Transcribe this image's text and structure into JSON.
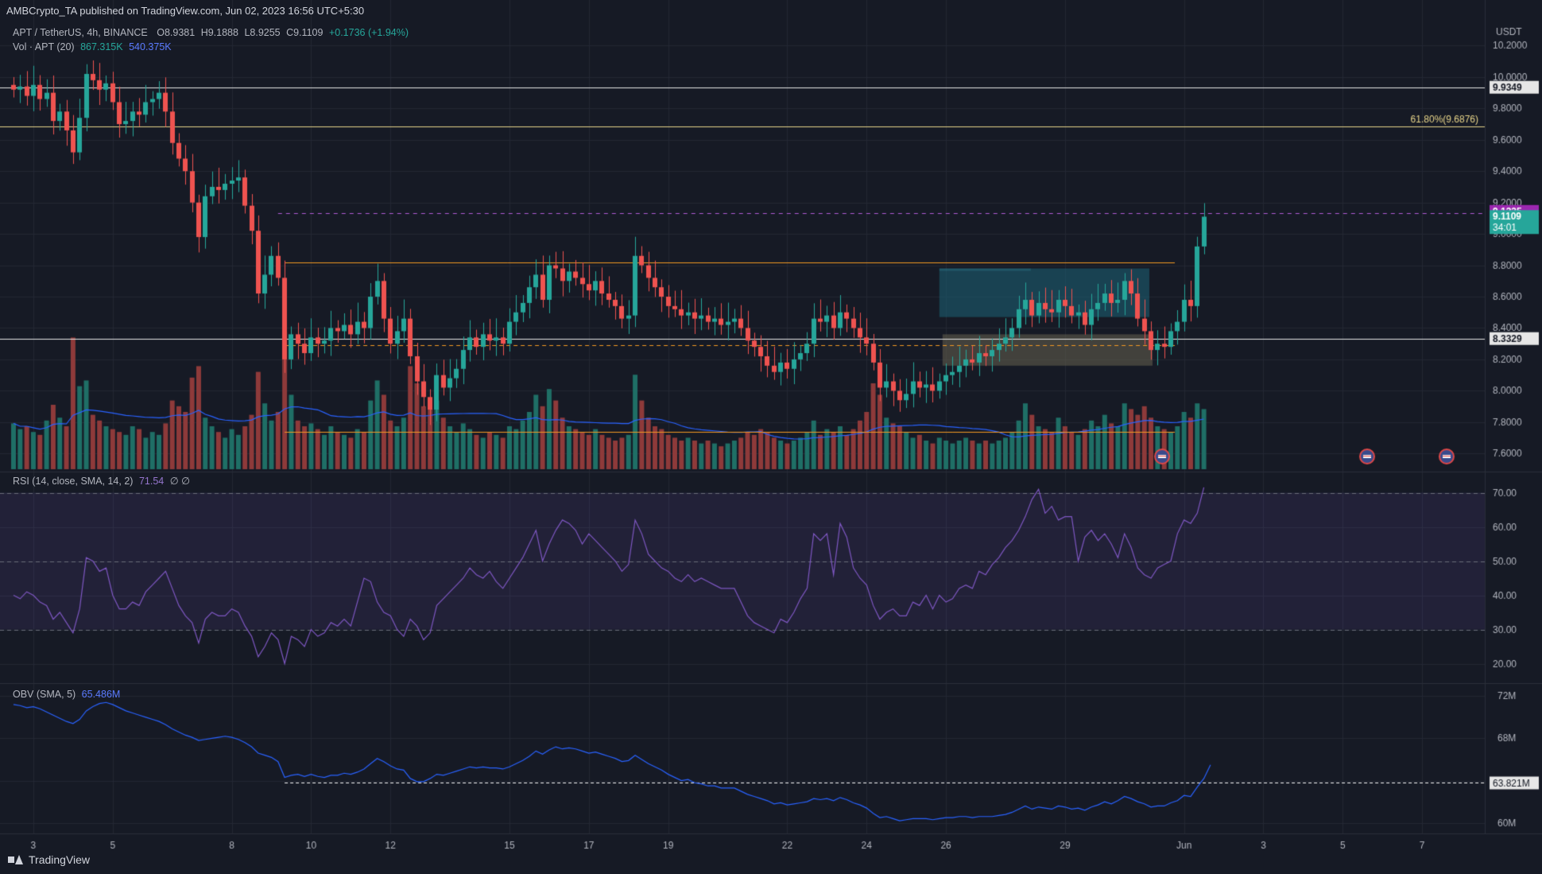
{
  "header": {
    "publisher": "AMBCrypto_TA published on TradingView.com, Jun 02, 2023 16:56 UTC+5:30"
  },
  "legend": {
    "symbol": "APT / TetherUS, 4h, BINANCE",
    "open": "O8.9381",
    "high": "H9.1888",
    "low": "L8.9255",
    "close": "C9.1109",
    "change": "+0.1736 (+1.94%)",
    "vol_label": "Vol · APT (20)",
    "vol_value": "867.315K",
    "vol_ma": "540.375K",
    "rsi_label": "RSI (14, close, SMA, 14, 2)",
    "rsi_value": "71.54",
    "rsi_extra": "∅ ∅",
    "obv_label": "OBV (SMA, 5)",
    "obv_value": "65.486M"
  },
  "brand": "TradingView",
  "colors": {
    "background": "#161a25",
    "up": "#26a69a",
    "down": "#ef5350",
    "vol_up": "#1f6f66",
    "vol_down": "#8e3a3a",
    "vol_ma": "#2962ff",
    "rsi": "#7e57c2",
    "obv": "#2962ff",
    "fib": "#e8d58a",
    "orange": "#f59a23",
    "pink_dash": "#b15bd6",
    "cyan_zone": "#1e5a6e",
    "gray_zone": "#5c5746",
    "price_tag": "#26a69a",
    "last_high_tag": "#9c27b0"
  },
  "chart_data": [
    {
      "type": "candlestick",
      "title": "APT / TetherUS, 4h, BINANCE",
      "y_unit": "USDT",
      "ylim": [
        7.5,
        10.4
      ],
      "price_ticks": [
        "10.2000",
        "10.0000",
        "9.8000",
        "9.6000",
        "9.4000",
        "9.2000",
        "9.0000",
        "8.8000",
        "8.6000",
        "8.4000",
        "8.2000",
        "8.0000",
        "7.8000",
        "7.6000"
      ],
      "x_ticks": [
        "3",
        "5",
        "8",
        "10",
        "12",
        "15",
        "17",
        "19",
        "22",
        "24",
        "26",
        "29",
        "Jun",
        "3",
        "5",
        "7"
      ],
      "x_tick_dates": [
        "2023-05-03",
        "2023-05-05",
        "2023-05-08",
        "2023-05-10",
        "2023-05-12",
        "2023-05-15",
        "2023-05-17",
        "2023-05-19",
        "2023-05-22",
        "2023-05-24",
        "2023-05-26",
        "2023-05-29",
        "2023-06-01",
        "2023-06-03",
        "2023-06-05",
        "2023-06-07"
      ],
      "bars_per_day": 6,
      "first_bar": "2023-05-02 12:00",
      "closes": [
        9.92,
        9.94,
        9.88,
        9.95,
        9.86,
        9.9,
        9.72,
        9.78,
        9.66,
        9.52,
        9.74,
        10.02,
        9.98,
        9.92,
        9.96,
        9.84,
        9.7,
        9.72,
        9.78,
        9.76,
        9.84,
        9.86,
        9.9,
        9.78,
        9.58,
        9.48,
        9.4,
        9.2,
        8.98,
        9.24,
        9.3,
        9.28,
        9.32,
        9.34,
        9.36,
        9.18,
        9.02,
        8.62,
        8.74,
        8.86,
        8.72,
        8.2,
        8.36,
        8.3,
        8.24,
        8.34,
        8.3,
        8.32,
        8.4,
        8.38,
        8.42,
        8.36,
        8.44,
        8.4,
        8.6,
        8.7,
        8.46,
        8.3,
        8.38,
        8.46,
        8.22,
        8.06,
        7.96,
        7.88,
        8.1,
        8.02,
        8.08,
        8.14,
        8.26,
        8.34,
        8.28,
        8.36,
        8.32,
        8.34,
        8.3,
        8.44,
        8.5,
        8.56,
        8.66,
        8.74,
        8.58,
        8.8,
        8.78,
        8.7,
        8.76,
        8.72,
        8.68,
        8.64,
        8.7,
        8.62,
        8.58,
        8.54,
        8.46,
        8.48,
        8.86,
        8.8,
        8.72,
        8.66,
        8.6,
        8.54,
        8.52,
        8.48,
        8.5,
        8.46,
        8.48,
        8.44,
        8.46,
        8.42,
        8.44,
        8.46,
        8.4,
        8.32,
        8.28,
        8.22,
        8.16,
        8.12,
        8.18,
        8.14,
        8.2,
        8.24,
        8.3,
        8.46,
        8.44,
        8.48,
        8.4,
        8.5,
        8.46,
        8.4,
        8.34,
        8.3,
        8.18,
        8.02,
        8.06,
        8.0,
        7.94,
        7.98,
        8.06,
        8.02,
        8.04,
        8.0,
        8.06,
        8.1,
        8.12,
        8.16,
        8.2,
        8.18,
        8.24,
        8.22,
        8.26,
        8.3,
        8.34,
        8.4,
        8.52,
        8.58,
        8.48,
        8.56,
        8.52,
        8.5,
        8.58,
        8.54,
        8.48,
        8.5,
        8.42,
        8.52,
        8.56,
        8.62,
        8.56,
        8.58,
        8.7,
        8.62,
        8.46,
        8.38,
        8.26,
        8.3,
        8.28,
        8.38,
        8.44,
        8.58,
        8.54,
        8.92,
        9.11
      ],
      "volume": [
        0.32,
        0.28,
        0.3,
        0.26,
        0.24,
        0.34,
        0.45,
        0.36,
        0.3,
        0.92,
        0.58,
        0.62,
        0.38,
        0.34,
        0.3,
        0.28,
        0.26,
        0.24,
        0.3,
        0.28,
        0.22,
        0.26,
        0.24,
        0.32,
        0.48,
        0.44,
        0.4,
        0.64,
        0.72,
        0.36,
        0.3,
        0.26,
        0.22,
        0.28,
        0.24,
        0.3,
        0.38,
        0.68,
        0.46,
        0.34,
        0.4,
        0.96,
        0.52,
        0.34,
        0.3,
        0.32,
        0.28,
        0.24,
        0.3,
        0.26,
        0.24,
        0.22,
        0.28,
        0.26,
        0.48,
        0.62,
        0.52,
        0.34,
        0.3,
        0.36,
        0.72,
        0.6,
        0.44,
        0.42,
        0.48,
        0.36,
        0.3,
        0.26,
        0.32,
        0.28,
        0.24,
        0.22,
        0.26,
        0.24,
        0.22,
        0.3,
        0.28,
        0.34,
        0.4,
        0.52,
        0.44,
        0.56,
        0.48,
        0.36,
        0.3,
        0.28,
        0.26,
        0.24,
        0.28,
        0.24,
        0.22,
        0.2,
        0.22,
        0.24,
        0.66,
        0.48,
        0.36,
        0.3,
        0.28,
        0.24,
        0.22,
        0.2,
        0.22,
        0.2,
        0.18,
        0.2,
        0.18,
        0.16,
        0.18,
        0.2,
        0.22,
        0.26,
        0.24,
        0.28,
        0.26,
        0.22,
        0.2,
        0.18,
        0.2,
        0.22,
        0.26,
        0.34,
        0.24,
        0.28,
        0.26,
        0.3,
        0.24,
        0.28,
        0.34,
        0.4,
        0.6,
        0.52,
        0.36,
        0.32,
        0.3,
        0.26,
        0.22,
        0.24,
        0.2,
        0.18,
        0.22,
        0.2,
        0.18,
        0.2,
        0.22,
        0.2,
        0.18,
        0.2,
        0.18,
        0.2,
        0.22,
        0.26,
        0.34,
        0.46,
        0.38,
        0.3,
        0.28,
        0.26,
        0.36,
        0.3,
        0.26,
        0.24,
        0.28,
        0.34,
        0.3,
        0.38,
        0.32,
        0.3,
        0.46,
        0.42,
        0.38,
        0.44,
        0.36,
        0.3,
        0.28,
        0.26,
        0.3,
        0.4,
        0.36,
        0.46,
        0.42
      ],
      "levels": [
        {
          "price": 9.9349,
          "label": "9.9349",
          "style": "solid-white"
        },
        {
          "price": 9.6876,
          "label": "61.80%(9.6876)",
          "style": "solid-fib"
        },
        {
          "price": 9.1335,
          "label": "9.1335",
          "style": "dashed-pink"
        },
        {
          "price": 8.82,
          "label": "",
          "style": "solid-orange"
        },
        {
          "price": 8.3329,
          "label": "8.3329",
          "style": "solid-white"
        },
        {
          "price": 8.29,
          "label": "",
          "style": "dashed-orange"
        },
        {
          "price": 7.74,
          "label": "",
          "style": "solid-orange"
        }
      ],
      "zones": [
        {
          "from": 8.47,
          "to": 8.78,
          "color": "cyan"
        },
        {
          "from": 8.16,
          "to": 8.36,
          "color": "gray"
        }
      ],
      "last_price_tag": {
        "price": "9.1109",
        "countdown": "34:01"
      }
    },
    {
      "type": "line",
      "title": "RSI (14, close, SMA, 14, 2)",
      "ylim": [
        15,
        75
      ],
      "ticks": [
        "70.00",
        "60.00",
        "50.00",
        "40.00",
        "30.00",
        "20.00"
      ],
      "band": [
        30,
        70
      ],
      "values": [
        40,
        39,
        41,
        40,
        38,
        37,
        33,
        35,
        32,
        29,
        36,
        51,
        50,
        47,
        48,
        40,
        36,
        36,
        38,
        37,
        41,
        43,
        45,
        47,
        42,
        37,
        34,
        32,
        26,
        33,
        35,
        34,
        34,
        36,
        35,
        31,
        28,
        22,
        25,
        29,
        27,
        20,
        28,
        27,
        25,
        30,
        28,
        29,
        32,
        31,
        33,
        31,
        38,
        45,
        44,
        38,
        35,
        34,
        30,
        28,
        33,
        31,
        27,
        29,
        37,
        39,
        41,
        43,
        45,
        48,
        46,
        45,
        47,
        44,
        42,
        45,
        48,
        51,
        55,
        59,
        50,
        55,
        59,
        62,
        61,
        59,
        55,
        58,
        56,
        54,
        52,
        50,
        47,
        49,
        62,
        58,
        52,
        50,
        48,
        47,
        45,
        44,
        46,
        44,
        45,
        44,
        43,
        42,
        42,
        42,
        38,
        34,
        32,
        31,
        30,
        29,
        33,
        32,
        35,
        39,
        42,
        58,
        56,
        58,
        46,
        61,
        57,
        48,
        45,
        43,
        37,
        33,
        35,
        36,
        34,
        34,
        38,
        37,
        40,
        36,
        40,
        38,
        39,
        42,
        43,
        42,
        47,
        46,
        49,
        51,
        54,
        56,
        59,
        63,
        68,
        71,
        64,
        66,
        62,
        63,
        63,
        50,
        57,
        59,
        56,
        58,
        55,
        51,
        58,
        54,
        48,
        46,
        45,
        48,
        49,
        50,
        58,
        62,
        61,
        64,
        71.54
      ]
    },
    {
      "type": "line",
      "title": "OBV (SMA, 5)",
      "y_unit": "M",
      "ylim": [
        59,
        73
      ],
      "ticks": [
        "72M",
        "68M",
        "64M",
        "60M"
      ],
      "reference": {
        "value": 63.821,
        "label": "63.821M"
      },
      "values": [
        71.2,
        71.1,
        70.9,
        71.0,
        70.8,
        70.5,
        70.2,
        69.9,
        69.6,
        69.4,
        69.8,
        70.6,
        71.0,
        71.3,
        71.4,
        71.2,
        70.9,
        70.6,
        70.4,
        70.2,
        70.0,
        69.8,
        69.6,
        69.3,
        68.9,
        68.6,
        68.3,
        68.1,
        67.8,
        67.9,
        68.0,
        68.1,
        68.2,
        68.1,
        67.9,
        67.6,
        67.2,
        66.6,
        66.4,
        66.2,
        65.8,
        64.3,
        64.5,
        64.6,
        64.4,
        64.6,
        64.4,
        64.3,
        64.5,
        64.5,
        64.7,
        64.6,
        64.8,
        65.1,
        65.6,
        66.1,
        65.8,
        65.4,
        65.1,
        65.0,
        64.2,
        63.9,
        63.9,
        64.2,
        64.6,
        64.5,
        64.7,
        64.9,
        65.1,
        65.3,
        65.2,
        65.3,
        65.2,
        65.2,
        65.1,
        65.3,
        65.6,
        65.9,
        66.3,
        66.8,
        66.5,
        66.9,
        67.2,
        67.0,
        67.1,
        67.0,
        66.8,
        66.6,
        66.7,
        66.5,
        66.3,
        66.1,
        65.8,
        65.9,
        66.4,
        66.0,
        65.6,
        65.3,
        65.0,
        64.6,
        64.3,
        64.0,
        64.1,
        63.8,
        63.7,
        63.5,
        63.5,
        63.3,
        63.3,
        63.3,
        63.0,
        62.7,
        62.5,
        62.3,
        62.1,
        61.8,
        61.9,
        61.7,
        61.8,
        61.9,
        62.0,
        62.3,
        62.2,
        62.3,
        62.1,
        62.4,
        62.2,
        61.9,
        61.7,
        61.4,
        60.9,
        60.5,
        60.6,
        60.4,
        60.2,
        60.3,
        60.4,
        60.4,
        60.4,
        60.3,
        60.4,
        60.5,
        60.5,
        60.6,
        60.6,
        60.5,
        60.6,
        60.6,
        60.6,
        60.7,
        60.8,
        61.0,
        61.3,
        61.6,
        61.3,
        61.5,
        61.4,
        61.3,
        61.6,
        61.5,
        61.3,
        61.4,
        61.2,
        61.5,
        61.7,
        62.0,
        61.8,
        62.1,
        62.5,
        62.3,
        62.0,
        61.8,
        61.5,
        61.6,
        61.6,
        61.9,
        62.1,
        62.6,
        62.5,
        63.4,
        64.2,
        65.486
      ]
    }
  ]
}
